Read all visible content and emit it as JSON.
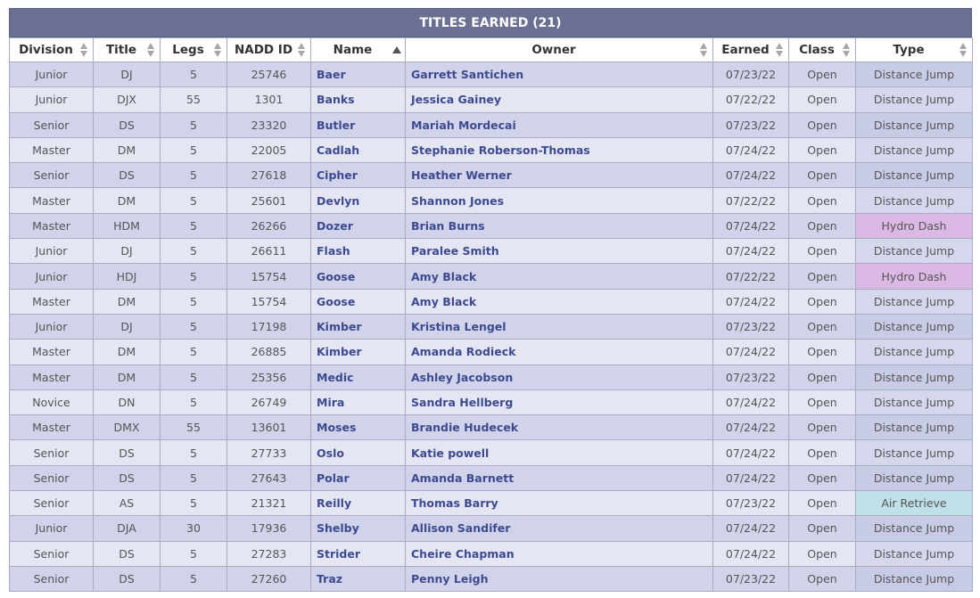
{
  "table_title": "TITLES EARNED (21)",
  "columns": [
    "Division",
    "Title",
    "Legs",
    "NADD ID",
    "Name",
    "Owner",
    "Earned",
    "Class",
    "Type"
  ],
  "sort": {
    "column": "Name",
    "direction": "asc"
  },
  "colors": {
    "title_bar": "#6b7093",
    "row_odd": "#d0d3ea",
    "row_even": "#e4e6f4",
    "type_distance_jump": "#c7cbe6",
    "type_hydro_dash": "#dcb8e5",
    "type_air_retrieve": "#bee0e6",
    "link_text": "#3e4a8f"
  },
  "rows": [
    {
      "division": "Junior",
      "title": "DJ",
      "legs": "5",
      "nadd_id": "25746",
      "name": "Baer",
      "owner": "Garrett Santichen",
      "earned": "07/23/22",
      "class": "Open",
      "type": "Distance Jump"
    },
    {
      "division": "Junior",
      "title": "DJX",
      "legs": "55",
      "nadd_id": "1301",
      "name": "Banks",
      "owner": "Jessica Gainey",
      "earned": "07/22/22",
      "class": "Open",
      "type": "Distance Jump"
    },
    {
      "division": "Senior",
      "title": "DS",
      "legs": "5",
      "nadd_id": "23320",
      "name": "Butler",
      "owner": "Mariah Mordecai",
      "earned": "07/23/22",
      "class": "Open",
      "type": "Distance Jump"
    },
    {
      "division": "Master",
      "title": "DM",
      "legs": "5",
      "nadd_id": "22005",
      "name": "Cadlah",
      "owner": "Stephanie Roberson-Thomas",
      "earned": "07/24/22",
      "class": "Open",
      "type": "Distance Jump"
    },
    {
      "division": "Senior",
      "title": "DS",
      "legs": "5",
      "nadd_id": "27618",
      "name": "Cipher",
      "owner": "Heather Werner",
      "earned": "07/24/22",
      "class": "Open",
      "type": "Distance Jump"
    },
    {
      "division": "Master",
      "title": "DM",
      "legs": "5",
      "nadd_id": "25601",
      "name": "Devlyn",
      "owner": "Shannon Jones",
      "earned": "07/22/22",
      "class": "Open",
      "type": "Distance Jump"
    },
    {
      "division": "Master",
      "title": "HDM",
      "legs": "5",
      "nadd_id": "26266",
      "name": "Dozer",
      "owner": "Brian Burns",
      "earned": "07/24/22",
      "class": "Open",
      "type": "Hydro Dash"
    },
    {
      "division": "Junior",
      "title": "DJ",
      "legs": "5",
      "nadd_id": "26611",
      "name": "Flash",
      "owner": "Paralee Smith",
      "earned": "07/24/22",
      "class": "Open",
      "type": "Distance Jump"
    },
    {
      "division": "Junior",
      "title": "HDJ",
      "legs": "5",
      "nadd_id": "15754",
      "name": "Goose",
      "owner": "Amy Black",
      "earned": "07/22/22",
      "class": "Open",
      "type": "Hydro Dash"
    },
    {
      "division": "Master",
      "title": "DM",
      "legs": "5",
      "nadd_id": "15754",
      "name": "Goose",
      "owner": "Amy Black",
      "earned": "07/24/22",
      "class": "Open",
      "type": "Distance Jump"
    },
    {
      "division": "Junior",
      "title": "DJ",
      "legs": "5",
      "nadd_id": "17198",
      "name": "Kimber",
      "owner": "Kristina Lengel",
      "earned": "07/23/22",
      "class": "Open",
      "type": "Distance Jump"
    },
    {
      "division": "Master",
      "title": "DM",
      "legs": "5",
      "nadd_id": "26885",
      "name": "Kimber",
      "owner": "Amanda Rodieck",
      "earned": "07/24/22",
      "class": "Open",
      "type": "Distance Jump"
    },
    {
      "division": "Master",
      "title": "DM",
      "legs": "5",
      "nadd_id": "25356",
      "name": "Medic",
      "owner": "Ashley Jacobson",
      "earned": "07/23/22",
      "class": "Open",
      "type": "Distance Jump"
    },
    {
      "division": "Novice",
      "title": "DN",
      "legs": "5",
      "nadd_id": "26749",
      "name": "Mira",
      "owner": "Sandra Hellberg",
      "earned": "07/24/22",
      "class": "Open",
      "type": "Distance Jump"
    },
    {
      "division": "Master",
      "title": "DMX",
      "legs": "55",
      "nadd_id": "13601",
      "name": "Moses",
      "owner": "Brandie Hudecek",
      "earned": "07/24/22",
      "class": "Open",
      "type": "Distance Jump"
    },
    {
      "division": "Senior",
      "title": "DS",
      "legs": "5",
      "nadd_id": "27733",
      "name": "Oslo",
      "owner": "Katie powell",
      "earned": "07/24/22",
      "class": "Open",
      "type": "Distance Jump"
    },
    {
      "division": "Senior",
      "title": "DS",
      "legs": "5",
      "nadd_id": "27643",
      "name": "Polar",
      "owner": "Amanda Barnett",
      "earned": "07/24/22",
      "class": "Open",
      "type": "Distance Jump"
    },
    {
      "division": "Senior",
      "title": "AS",
      "legs": "5",
      "nadd_id": "21321",
      "name": "Reilly",
      "owner": "Thomas Barry",
      "earned": "07/23/22",
      "class": "Open",
      "type": "Air Retrieve"
    },
    {
      "division": "Junior",
      "title": "DJA",
      "legs": "30",
      "nadd_id": "17936",
      "name": "Shelby",
      "owner": "Allison Sandifer",
      "earned": "07/24/22",
      "class": "Open",
      "type": "Distance Jump"
    },
    {
      "division": "Senior",
      "title": "DS",
      "legs": "5",
      "nadd_id": "27283",
      "name": "Strider",
      "owner": "Cheire Chapman",
      "earned": "07/24/22",
      "class": "Open",
      "type": "Distance Jump"
    },
    {
      "division": "Senior",
      "title": "DS",
      "legs": "5",
      "nadd_id": "27260",
      "name": "Traz",
      "owner": "Penny Leigh",
      "earned": "07/23/22",
      "class": "Open",
      "type": "Distance Jump"
    }
  ]
}
